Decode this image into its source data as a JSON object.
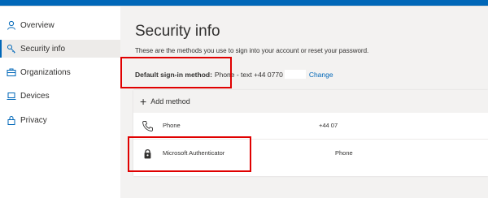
{
  "sidebar": {
    "items": [
      {
        "label": "Overview",
        "icon": "person-icon",
        "active": false
      },
      {
        "label": "Security info",
        "icon": "security-key-icon",
        "active": true
      },
      {
        "label": "Organizations",
        "icon": "briefcase-icon",
        "active": false
      },
      {
        "label": "Devices",
        "icon": "laptop-icon",
        "active": false
      },
      {
        "label": "Privacy",
        "icon": "lock-icon",
        "active": false
      }
    ]
  },
  "main": {
    "title": "Security info",
    "description": "These are the methods you use to sign into your account or reset your password.",
    "default_method": {
      "label": "Default sign-in method:",
      "value": "Phone - text +44 0770",
      "change_link": "Change"
    },
    "add_method_label": "Add method",
    "methods": [
      {
        "icon": "phone-icon",
        "name": "Phone",
        "value": "+44 07"
      },
      {
        "icon": "authenticator-icon",
        "name": "Microsoft Authenticator",
        "value": "Phone"
      }
    ]
  },
  "colors": {
    "accent": "#0067b8",
    "highlight": "#e00000",
    "main_background": "#f3f2f1"
  }
}
